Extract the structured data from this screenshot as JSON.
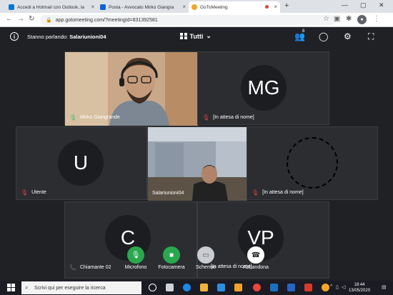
{
  "browser": {
    "tabs": [
      {
        "label": "Accedi a Hotmail con Outlook, la",
        "color": "#0078d4"
      },
      {
        "label": "Posta - Avvocato Mirko Giangra",
        "color": "#0a64d6"
      },
      {
        "label": "GoToMeeting",
        "color": "#f5a623"
      }
    ],
    "url": "app.gotomeeting.com/?meetingId=831392581"
  },
  "meeting": {
    "speaking_label": "Stanno parlando:",
    "speaking_name": "Salariunioni04",
    "view_label": "Tutti",
    "participants_badge": "8",
    "tiles": [
      {
        "name": "Mirko Giangrande",
        "initials": "",
        "mic": "on"
      },
      {
        "name": "[In attesa di nome]",
        "initials": "MG",
        "mic": "off"
      },
      {
        "name": "Utente",
        "initials": "U",
        "mic": "off"
      },
      {
        "name": "Salariunioni04",
        "initials": "",
        "mic": "none"
      },
      {
        "name": "[In attesa di nome]",
        "initials": "",
        "mic": "off"
      },
      {
        "name": "Chiamante 02",
        "initials": "C",
        "mic": "phone"
      },
      {
        "name": "[In attesa di nome]",
        "initials": "VP",
        "mic": "none"
      }
    ]
  },
  "controls": [
    {
      "label": "Microfono",
      "icon": "microphone-icon",
      "color": "#2aa84e"
    },
    {
      "label": "Fotocamera",
      "icon": "camera-icon",
      "color": "#2aa84e"
    },
    {
      "label": "Schermo",
      "icon": "screen-icon",
      "color": "#c9ccd1"
    },
    {
      "label": "Abbandona",
      "icon": "hangup-icon",
      "color": "#ffffff"
    }
  ],
  "taskbar": {
    "search_placeholder": "Scrivi qui per eseguire la ricerca",
    "time": "18:44",
    "date": "13/05/2020"
  }
}
